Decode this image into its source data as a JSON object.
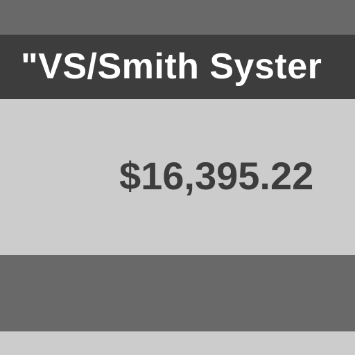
{
  "header": {
    "title": "\"VS/Smith Syster"
  },
  "main": {
    "amount": "$16,395.22"
  },
  "colors": {
    "top_band": "#696969",
    "title_bar": "#3d3d3d",
    "title_text": "#ffffff",
    "panel": "#cccccc",
    "amount_text": "#3d3d3d",
    "bottom_band": "#696969"
  }
}
